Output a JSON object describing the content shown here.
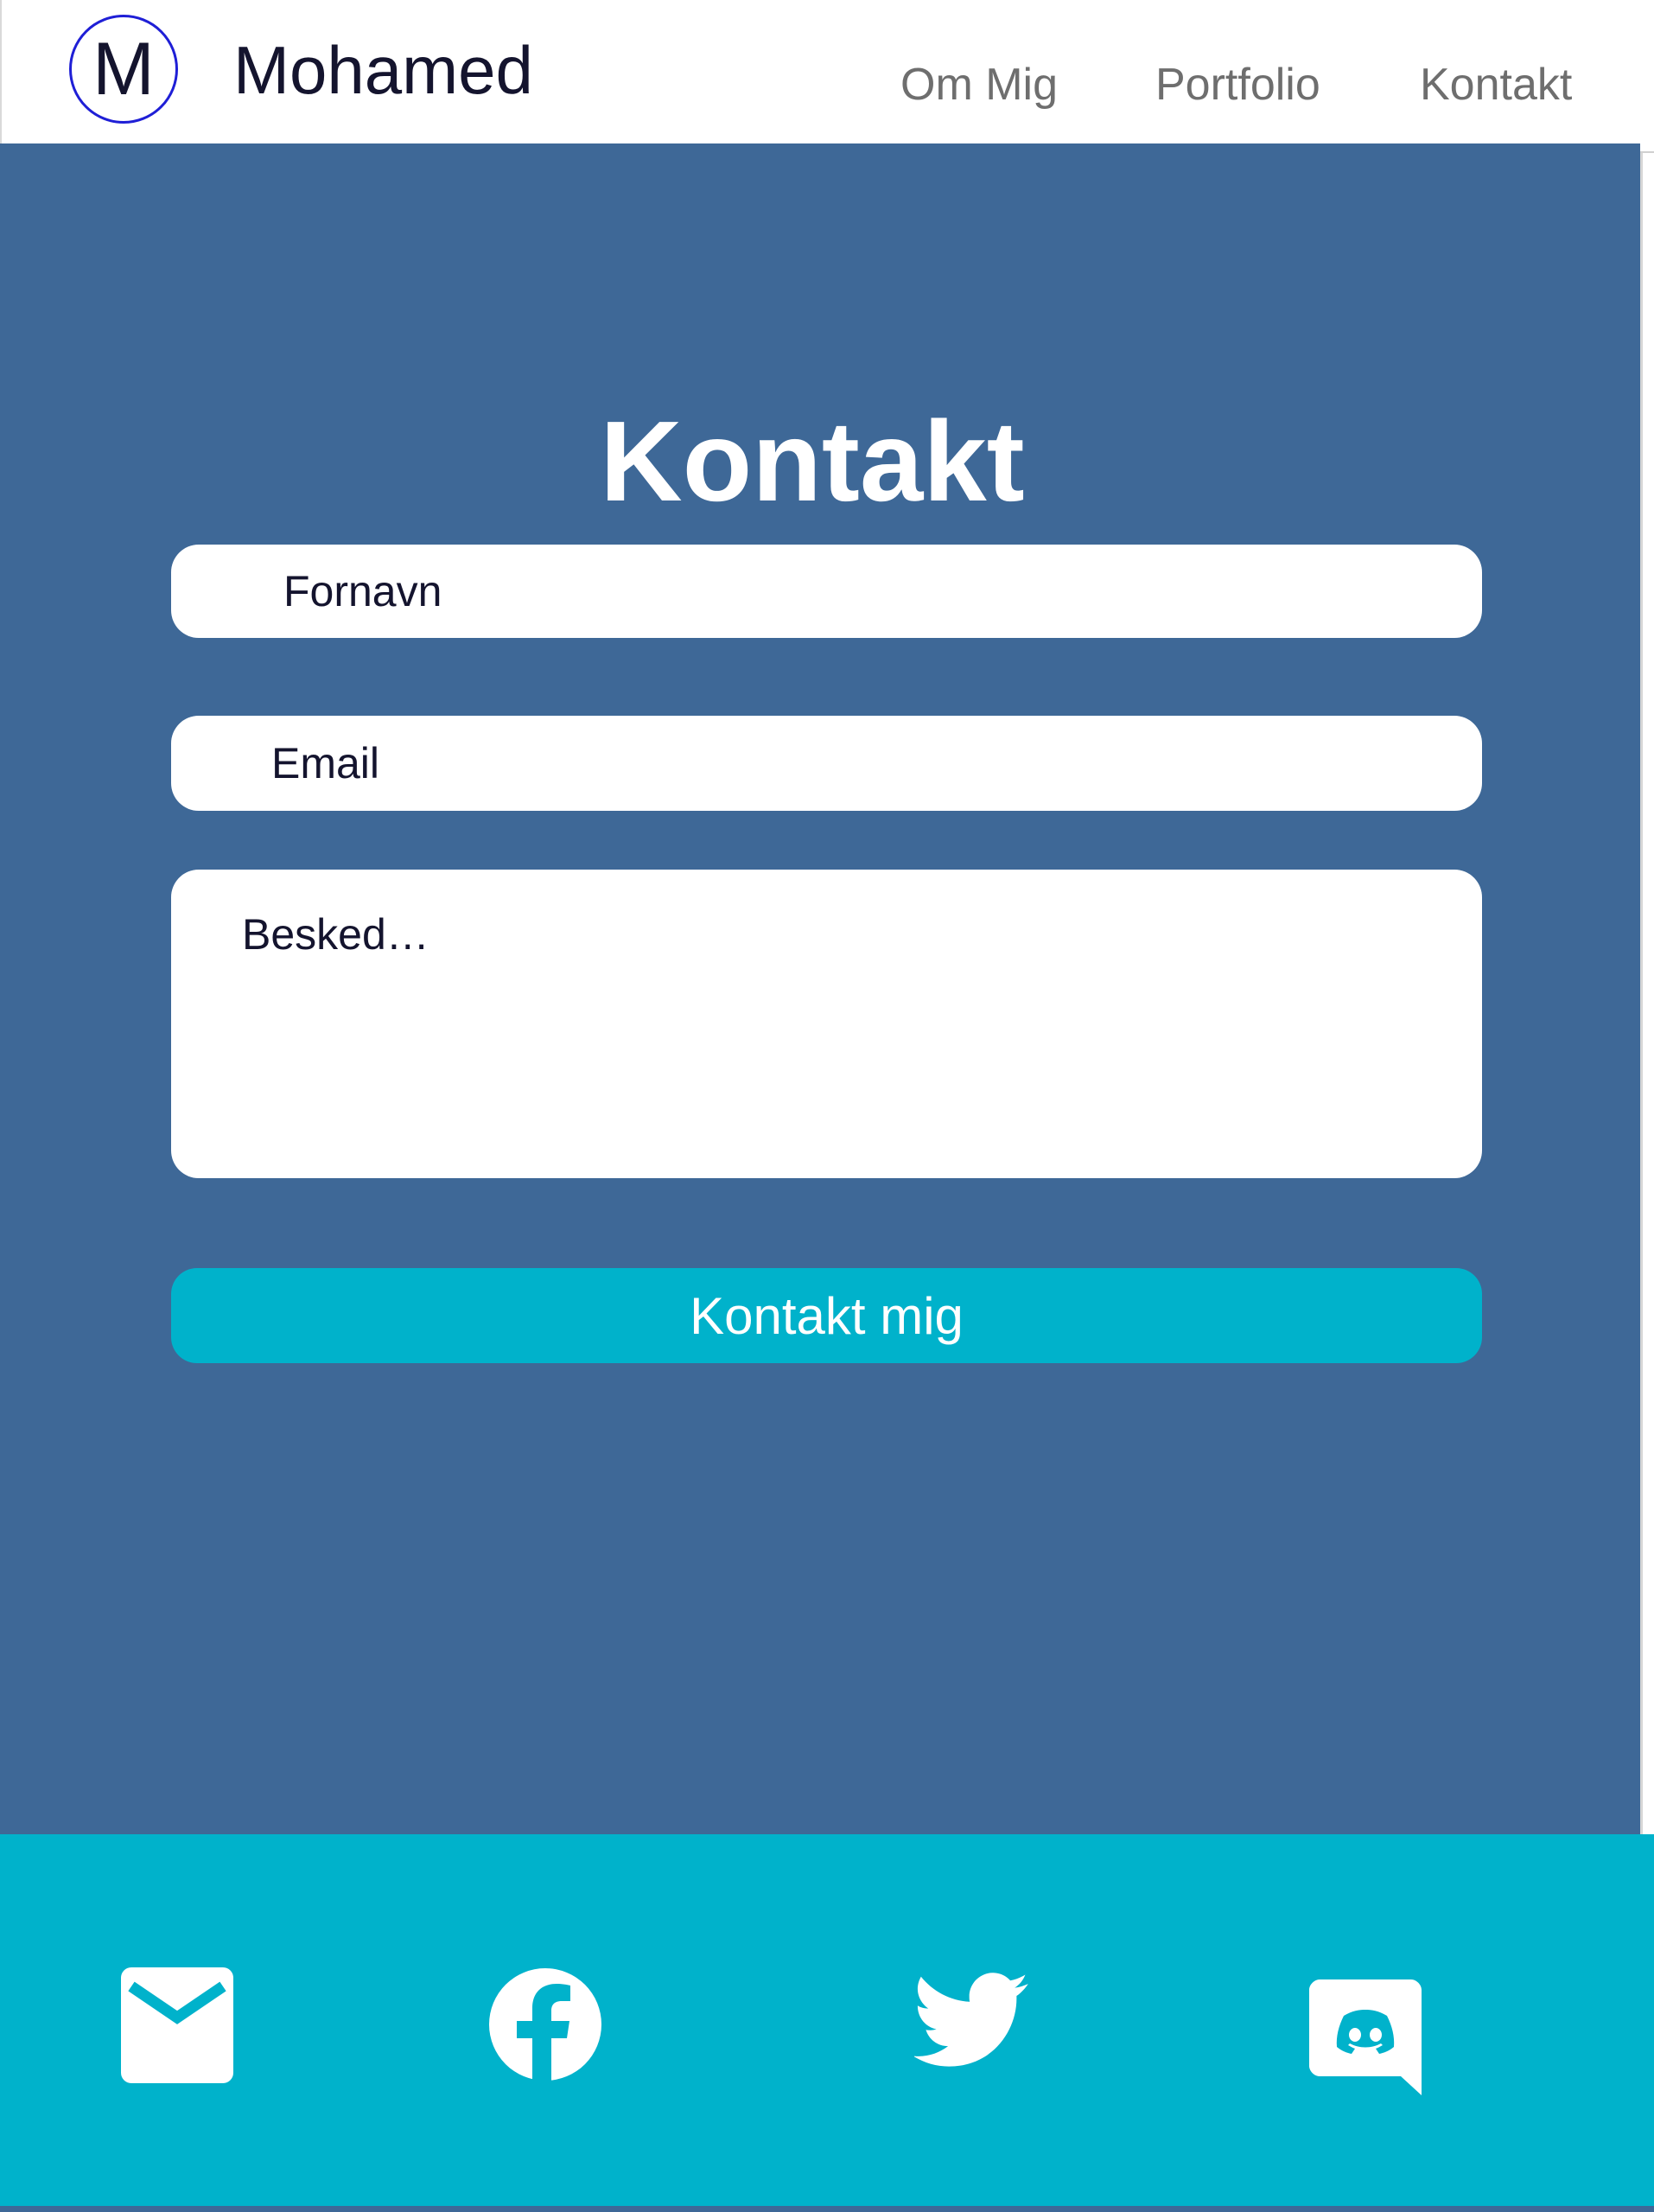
{
  "header": {
    "logo_letter": "M",
    "brand_name": "Mohamed",
    "nav": [
      {
        "label": "Om Mig"
      },
      {
        "label": "Portfolio"
      },
      {
        "label": "Kontakt"
      }
    ]
  },
  "contact": {
    "title": "Kontakt",
    "first_name_placeholder": "Fornavn",
    "email_placeholder": "Email",
    "message_placeholder": "Besked…",
    "submit_label": "Kontakt mig"
  },
  "footer": {
    "social_icons": [
      "mail-icon",
      "facebook-icon",
      "twitter-icon",
      "discord-icon"
    ]
  },
  "colors": {
    "main_background": "#3e6897",
    "accent": "#00b2cb",
    "logo_ring": "#1f1fd6",
    "text_dark": "#14142e",
    "nav_text": "#6e6e6e"
  }
}
